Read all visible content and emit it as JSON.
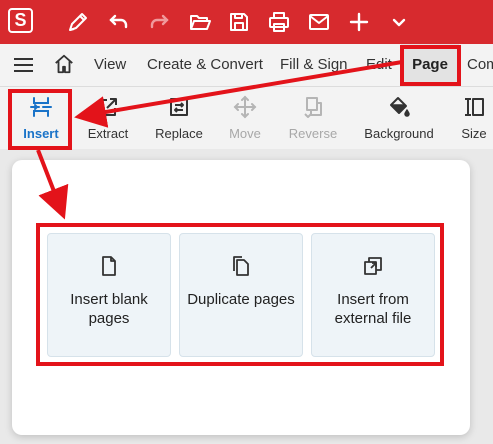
{
  "app": {
    "logo_letter": "S"
  },
  "toolbar": {
    "icons": [
      "pen-icon",
      "undo-icon",
      "redo-icon",
      "open-folder-icon",
      "save-icon",
      "print-icon",
      "email-icon",
      "add-icon",
      "more-chevron-icon"
    ]
  },
  "menu": {
    "items": [
      "View",
      "Create & Convert",
      "Fill & Sign",
      "Edit",
      "Page",
      "Com"
    ],
    "active": "Page"
  },
  "ribbon": {
    "buttons": [
      {
        "label": "Insert",
        "state": "active"
      },
      {
        "label": "Extract",
        "state": "enabled"
      },
      {
        "label": "Replace",
        "state": "enabled"
      },
      {
        "label": "Move",
        "state": "disabled"
      },
      {
        "label": "Reverse",
        "state": "disabled"
      },
      {
        "label": "Background",
        "state": "enabled"
      },
      {
        "label": "Size",
        "state": "enabled"
      }
    ]
  },
  "insert_menu": {
    "options": [
      {
        "label": "Insert blank pages",
        "icon": "blank-page-icon"
      },
      {
        "label": "Duplicate pages",
        "icon": "duplicate-pages-icon"
      },
      {
        "label": "Insert from external file",
        "icon": "external-file-icon"
      }
    ]
  },
  "colors": {
    "titlebar": "#d72a2e",
    "highlight": "#e3131a",
    "active_blue": "#1a73c8",
    "card_bg": "#eef4f8"
  }
}
